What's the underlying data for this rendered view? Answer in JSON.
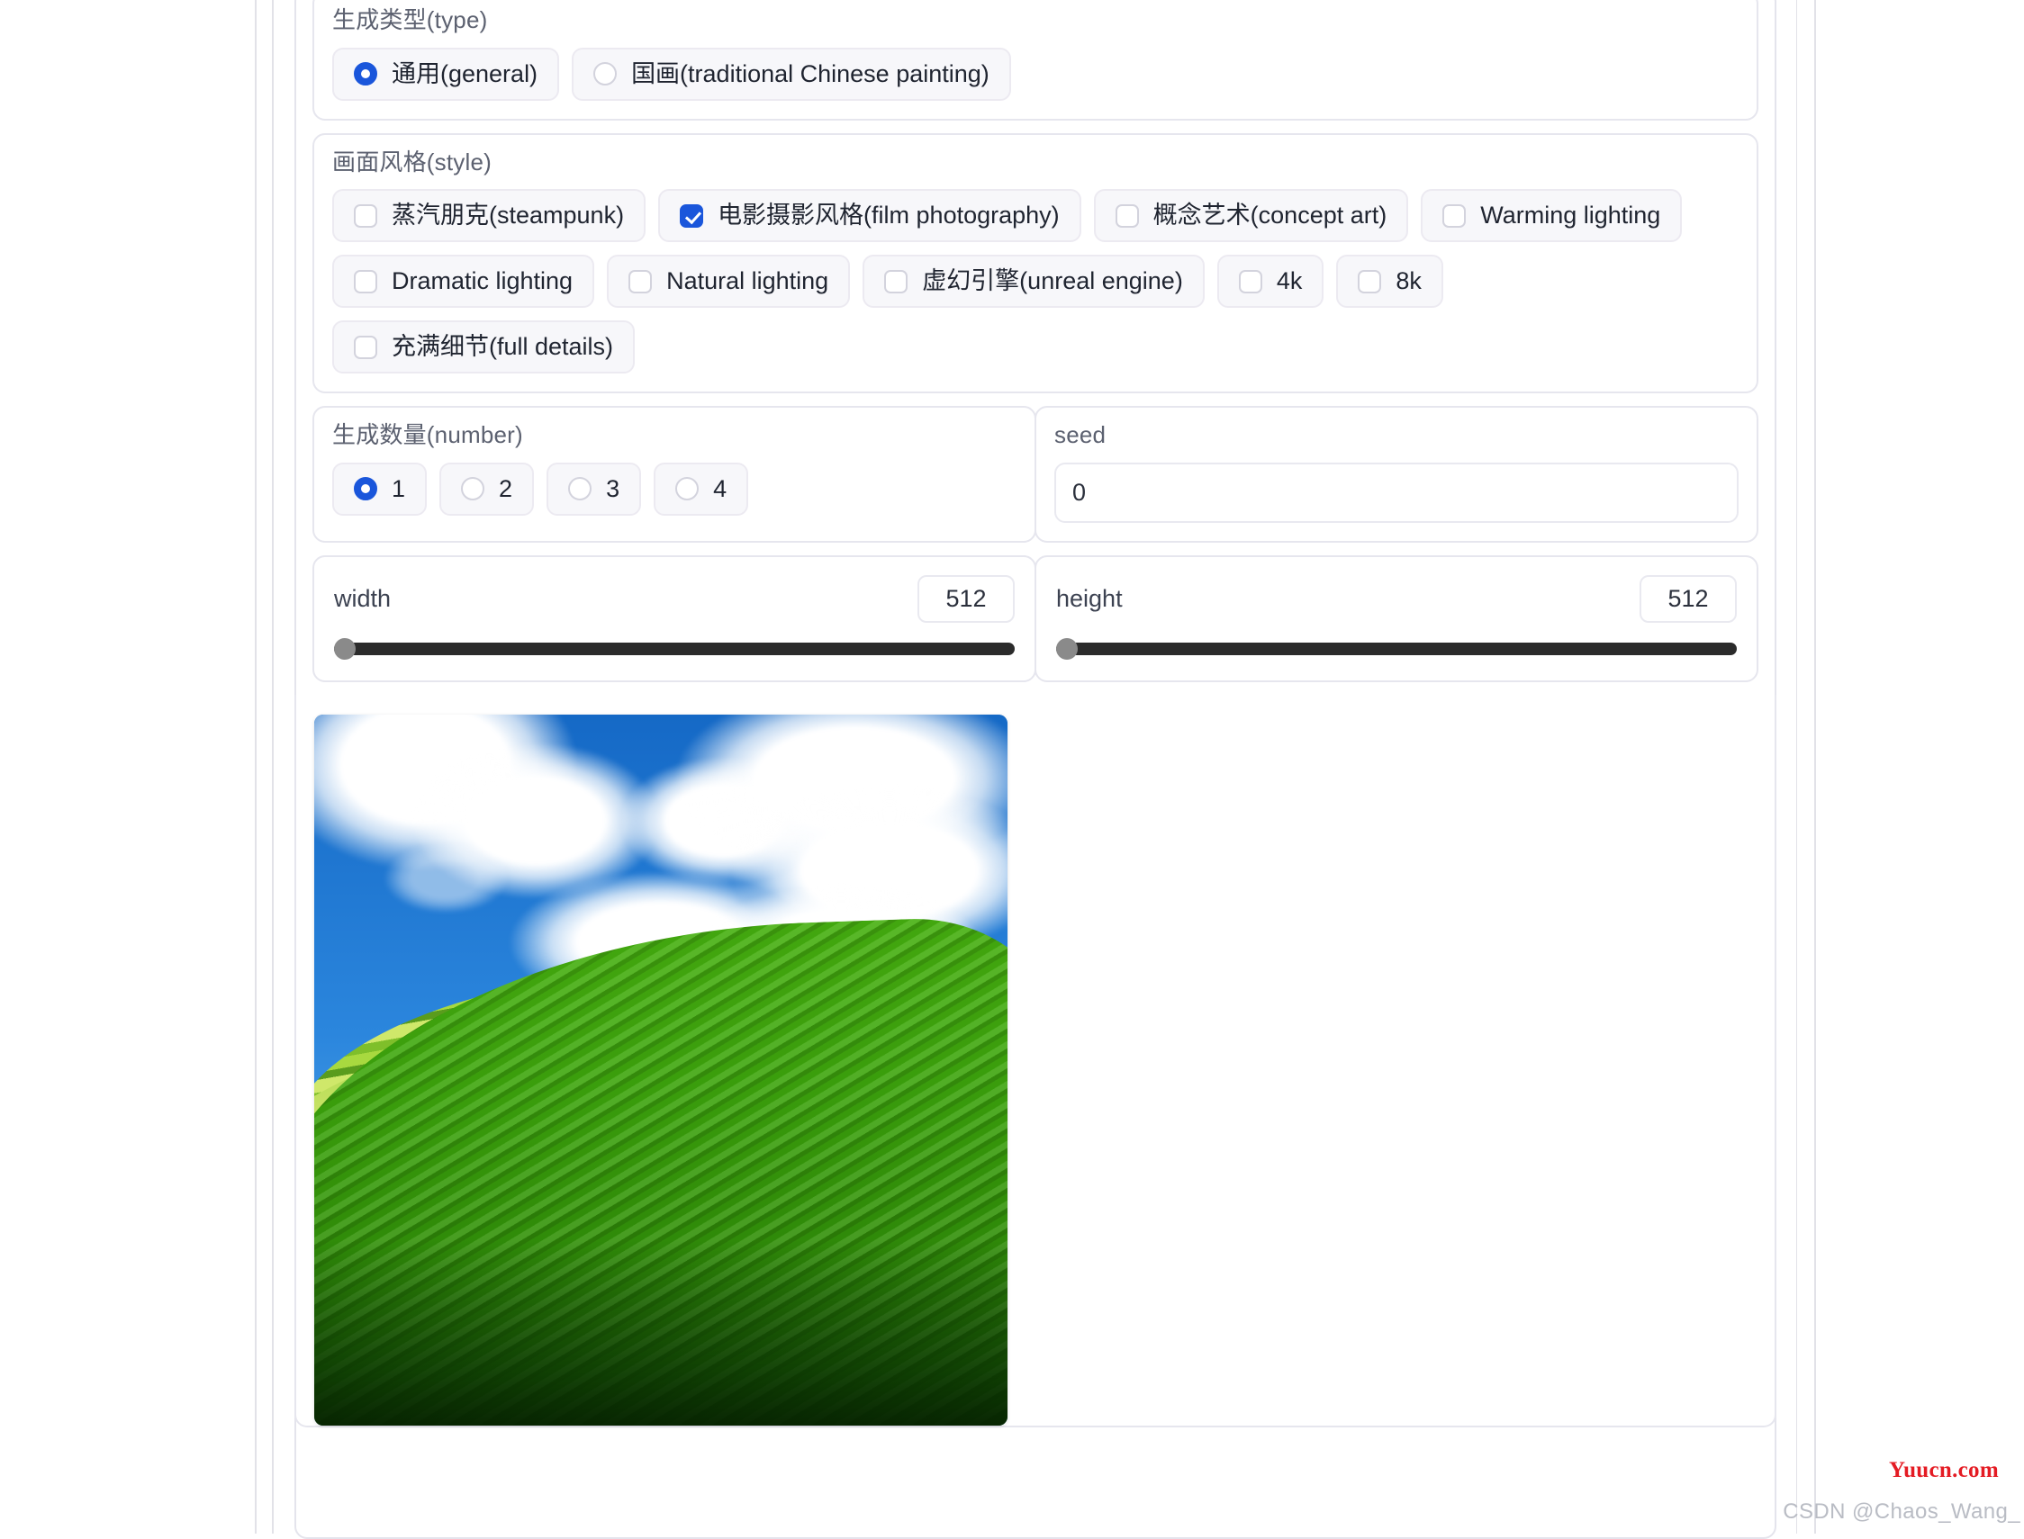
{
  "type_section": {
    "title": "生成类型(type)",
    "options": [
      {
        "label": "通用(general)",
        "selected": true
      },
      {
        "label": "国画(traditional Chinese painting)",
        "selected": false
      }
    ]
  },
  "style_section": {
    "title": "画面风格(style)",
    "options": [
      {
        "label": "蒸汽朋克(steampunk)",
        "checked": false
      },
      {
        "label": "电影摄影风格(film photography)",
        "checked": true
      },
      {
        "label": "概念艺术(concept art)",
        "checked": false
      },
      {
        "label": "Warming lighting",
        "checked": false
      },
      {
        "label": "Dramatic lighting",
        "checked": false
      },
      {
        "label": "Natural lighting",
        "checked": false
      },
      {
        "label": "虚幻引擎(unreal engine)",
        "checked": false
      },
      {
        "label": "4k",
        "checked": false
      },
      {
        "label": "8k",
        "checked": false
      },
      {
        "label": "充满细节(full details)",
        "checked": false
      }
    ]
  },
  "number_section": {
    "title": "生成数量(number)",
    "options": [
      {
        "label": "1",
        "selected": true
      },
      {
        "label": "2",
        "selected": false
      },
      {
        "label": "3",
        "selected": false
      },
      {
        "label": "4",
        "selected": false
      }
    ]
  },
  "seed_section": {
    "title": "seed",
    "value": "0",
    "placeholder": "0"
  },
  "width_slider": {
    "label": "width",
    "value": "512",
    "percent": 0
  },
  "height_slider": {
    "label": "height",
    "value": "512",
    "percent": 0
  },
  "result": {
    "alt": "generated-landscape-image"
  },
  "watermarks": {
    "red": "Yuucn.com",
    "gray": "CSDN @Chaos_Wang_"
  },
  "colors": {
    "accent": "#1A56DB",
    "chip_bg": "#F7F7FA",
    "border": "#E6E6EE",
    "track": "#2B2B2B",
    "thumb": "#8A8A8A",
    "watermark_red": "#E41B23"
  }
}
